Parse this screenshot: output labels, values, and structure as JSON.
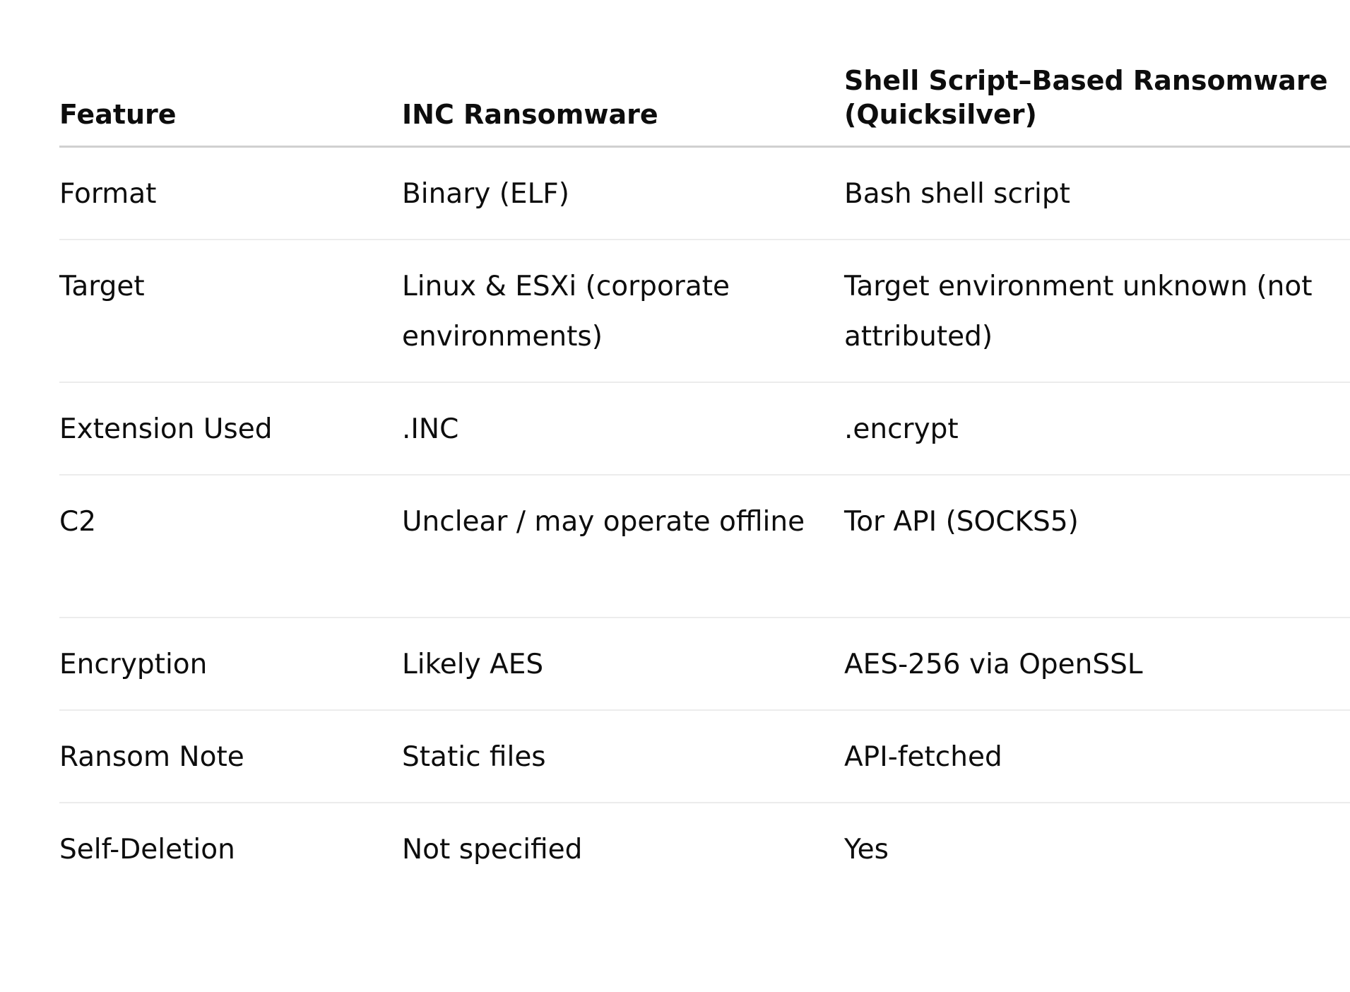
{
  "table": {
    "headers": [
      "Feature",
      "INC Ransomware",
      [
        "Shell Script–Based Ransomware",
        "(Quicksilver)"
      ]
    ],
    "rows": [
      {
        "feature": "Format",
        "inc": "Binary (ELF)",
        "shell": "Bash shell script"
      },
      {
        "feature": "Target",
        "inc": "Linux & ESXi (corporate environments)",
        "shell": "Target environment unknown (not attributed)"
      },
      {
        "feature": "Extension Used",
        "inc": ".INC",
        "shell": ".encrypt"
      },
      {
        "feature": "C2",
        "inc": "Unclear / may operate offline",
        "shell": "Tor API (SOCKS5)"
      },
      {
        "feature": "Encryption",
        "inc": "Likely AES",
        "shell": "AES-256 via OpenSSL"
      },
      {
        "feature": "Ransom Note",
        "inc": "Static files",
        "shell": "API-fetched"
      },
      {
        "feature": "Self-Deletion",
        "inc": "Not specified",
        "shell": "Yes"
      }
    ]
  }
}
